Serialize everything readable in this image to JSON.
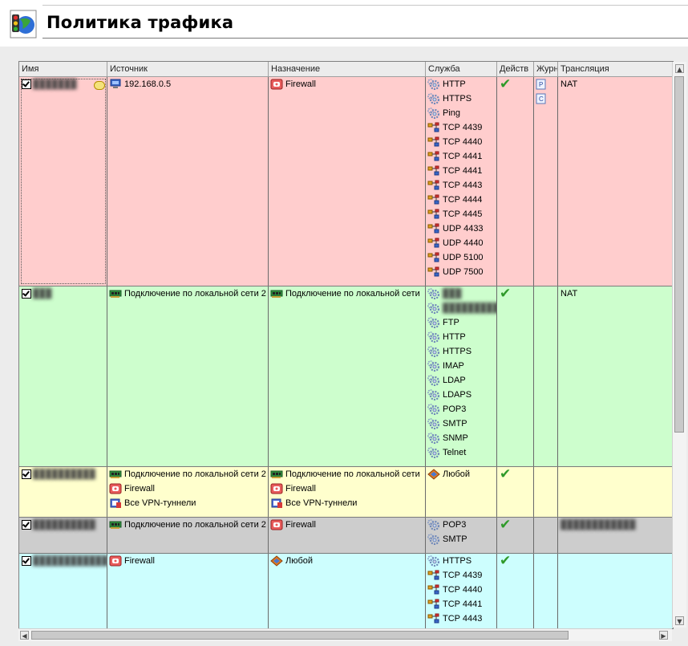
{
  "title": "Политика трафика",
  "columns": [
    "Имя",
    "Источник",
    "Назначение",
    "Служба",
    "Действ",
    "Журн",
    "Трансляция"
  ],
  "colors": {
    "row_pink": "#ffcdcd",
    "row_green": "#cdfecd",
    "row_yellow": "#ffffcd",
    "row_gray": "#cdcdcd",
    "row_cyan": "#cdfefe",
    "tick": "#2f9a2a"
  },
  "rows": [
    {
      "name": "███████",
      "source": [
        {
          "icon": "computer-icon",
          "text": "192.168.0.5"
        }
      ],
      "destination": [
        {
          "icon": "firewall-icon",
          "text": "Firewall"
        }
      ],
      "services": [
        {
          "icon": "service-gear-icon",
          "text": "HTTP"
        },
        {
          "icon": "service-gear-icon",
          "text": "HTTPS"
        },
        {
          "icon": "service-gear-icon",
          "text": "Ping"
        },
        {
          "icon": "port-icon",
          "text": "TCP 4439"
        },
        {
          "icon": "port-icon",
          "text": "TCP 4440"
        },
        {
          "icon": "port-icon",
          "text": "TCP 4441"
        },
        {
          "icon": "port-icon",
          "text": "TCP 4441"
        },
        {
          "icon": "port-icon",
          "text": "TCP 4443"
        },
        {
          "icon": "port-icon",
          "text": "TCP 4444"
        },
        {
          "icon": "port-icon",
          "text": "TCP 4445"
        },
        {
          "icon": "port-icon",
          "text": "UDP 4433"
        },
        {
          "icon": "port-icon",
          "text": "UDP 4440"
        },
        {
          "icon": "port-icon",
          "text": "UDP 5100"
        },
        {
          "icon": "port-icon",
          "text": "UDP 7500"
        }
      ],
      "action": "✔",
      "log": [
        "log-p-icon",
        "log-c-icon"
      ],
      "translation": "NAT"
    },
    {
      "name": "███",
      "source": [
        {
          "icon": "network-card-icon",
          "text": "Подключение по локальной сети 2"
        }
      ],
      "destination": [
        {
          "icon": "network-card-icon",
          "text": "Подключение по локальной сети"
        }
      ],
      "services": [
        {
          "icon": "service-gear-icon",
          "text": "███"
        },
        {
          "icon": "service-gear-icon",
          "text": "████████████"
        },
        {
          "icon": "service-gear-icon",
          "text": "FTP"
        },
        {
          "icon": "service-gear-icon",
          "text": "HTTP"
        },
        {
          "icon": "service-gear-icon",
          "text": "HTTPS"
        },
        {
          "icon": "service-gear-icon",
          "text": "IMAP"
        },
        {
          "icon": "service-gear-icon",
          "text": "LDAP"
        },
        {
          "icon": "service-gear-icon",
          "text": "LDAPS"
        },
        {
          "icon": "service-gear-icon",
          "text": "POP3"
        },
        {
          "icon": "service-gear-icon",
          "text": "SMTP"
        },
        {
          "icon": "service-gear-icon",
          "text": "SNMP"
        },
        {
          "icon": "service-gear-icon",
          "text": "Telnet"
        }
      ],
      "action": "✔",
      "translation": "NAT"
    },
    {
      "name": "██████████",
      "source": [
        {
          "icon": "network-card-icon",
          "text": "Подключение по локальной сети 2"
        },
        {
          "icon": "firewall-icon",
          "text": "Firewall"
        },
        {
          "icon": "vpn-icon",
          "text": "Все VPN-туннели"
        }
      ],
      "destination": [
        {
          "icon": "network-card-icon",
          "text": "Подключение по локальной сети"
        },
        {
          "icon": "firewall-icon",
          "text": "Firewall"
        },
        {
          "icon": "vpn-icon",
          "text": "Все VPN-туннели"
        }
      ],
      "services": [
        {
          "icon": "any-icon",
          "text": "Любой"
        }
      ],
      "action": "✔",
      "translation": ""
    },
    {
      "name": "██████████",
      "source": [
        {
          "icon": "network-card-icon",
          "text": "Подключение по локальной сети 2"
        }
      ],
      "destination": [
        {
          "icon": "firewall-icon",
          "text": "Firewall"
        }
      ],
      "services": [
        {
          "icon": "service-gear-icon",
          "text": "POP3"
        },
        {
          "icon": "service-gear-icon",
          "text": "SMTP"
        }
      ],
      "action": "✔",
      "translation": "████████████"
    },
    {
      "name": "████████████",
      "source": [
        {
          "icon": "firewall-icon",
          "text": "Firewall"
        }
      ],
      "destination": [
        {
          "icon": "any-icon",
          "text": "Любой"
        }
      ],
      "services": [
        {
          "icon": "service-gear-icon",
          "text": "HTTPS"
        },
        {
          "icon": "port-icon",
          "text": "TCP 4439"
        },
        {
          "icon": "port-icon",
          "text": "TCP 4440"
        },
        {
          "icon": "port-icon",
          "text": "TCP 4441"
        },
        {
          "icon": "port-icon",
          "text": "TCP 4443"
        }
      ],
      "action": "✔",
      "translation": ""
    }
  ]
}
